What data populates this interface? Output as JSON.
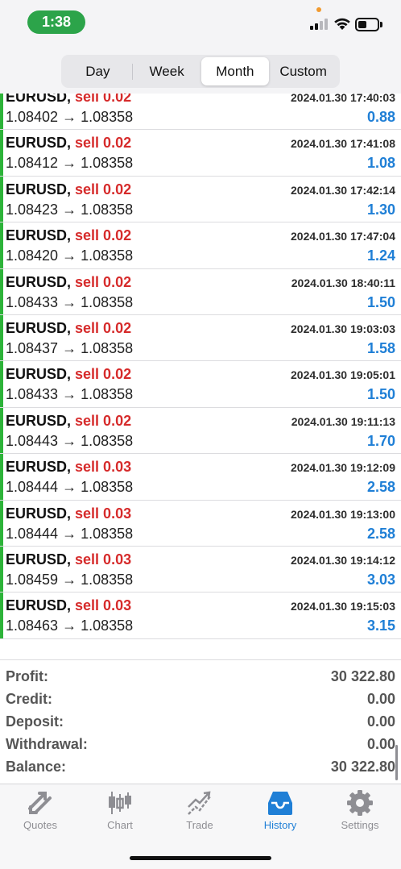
{
  "status_bar": {
    "time": "1:38",
    "icons": [
      "orange-dot",
      "cellular-signal-icon",
      "wifi-icon",
      "battery-icon"
    ]
  },
  "period_selector": {
    "options": [
      "Day",
      "Week",
      "Month",
      "Custom"
    ],
    "selected": "Month"
  },
  "deals": [
    {
      "symbol": "EURUSD,",
      "side": "sell 0.02",
      "time": "2024.01.30 17:40:03",
      "prices": "1.08402 → 1.08358",
      "profit": "0.88"
    },
    {
      "symbol": "EURUSD,",
      "side": "sell 0.02",
      "time": "2024.01.30 17:41:08",
      "prices": "1.08412 → 1.08358",
      "profit": "1.08"
    },
    {
      "symbol": "EURUSD,",
      "side": "sell 0.02",
      "time": "2024.01.30 17:42:14",
      "prices": "1.08423 → 1.08358",
      "profit": "1.30"
    },
    {
      "symbol": "EURUSD,",
      "side": "sell 0.02",
      "time": "2024.01.30 17:47:04",
      "prices": "1.08420 → 1.08358",
      "profit": "1.24"
    },
    {
      "symbol": "EURUSD,",
      "side": "sell 0.02",
      "time": "2024.01.30 18:40:11",
      "prices": "1.08433 → 1.08358",
      "profit": "1.50"
    },
    {
      "symbol": "EURUSD,",
      "side": "sell 0.02",
      "time": "2024.01.30 19:03:03",
      "prices": "1.08437 → 1.08358",
      "profit": "1.58"
    },
    {
      "symbol": "EURUSD,",
      "side": "sell 0.02",
      "time": "2024.01.30 19:05:01",
      "prices": "1.08433 → 1.08358",
      "profit": "1.50"
    },
    {
      "symbol": "EURUSD,",
      "side": "sell 0.02",
      "time": "2024.01.30 19:11:13",
      "prices": "1.08443 → 1.08358",
      "profit": "1.70"
    },
    {
      "symbol": "EURUSD,",
      "side": "sell 0.03",
      "time": "2024.01.30 19:12:09",
      "prices": "1.08444 → 1.08358",
      "profit": "2.58"
    },
    {
      "symbol": "EURUSD,",
      "side": "sell 0.03",
      "time": "2024.01.30 19:13:00",
      "prices": "1.08444 → 1.08358",
      "profit": "2.58"
    },
    {
      "symbol": "EURUSD,",
      "side": "sell 0.03",
      "time": "2024.01.30 19:14:12",
      "prices": "1.08459 → 1.08358",
      "profit": "3.03"
    },
    {
      "symbol": "EURUSD,",
      "side": "sell 0.03",
      "time": "2024.01.30 19:15:03",
      "prices": "1.08463 → 1.08358",
      "profit": "3.15"
    }
  ],
  "summary": {
    "profit_label": "Profit:",
    "profit_value": "30 322.80",
    "credit_label": "Credit:",
    "credit_value": "0.00",
    "deposit_label": "Deposit:",
    "deposit_value": "0.00",
    "withdrawal_label": "Withdrawal:",
    "withdrawal_value": "0.00",
    "balance_label": "Balance:",
    "balance_value": "30 322.80"
  },
  "tabbar": {
    "items": [
      {
        "label": "Quotes",
        "icon": "quotes-icon"
      },
      {
        "label": "Chart",
        "icon": "chart-icon"
      },
      {
        "label": "Trade",
        "icon": "trade-icon"
      },
      {
        "label": "History",
        "icon": "history-icon"
      },
      {
        "label": "Settings",
        "icon": "gear-icon"
      }
    ],
    "active": "History"
  },
  "colors": {
    "positive": "#1f7fd6",
    "sell": "#d62b2b",
    "row_marker": "#2db339",
    "time_pill": "#2ca44a",
    "tab_active": "#1f7fd6",
    "tab_inactive": "#8e8e93"
  }
}
